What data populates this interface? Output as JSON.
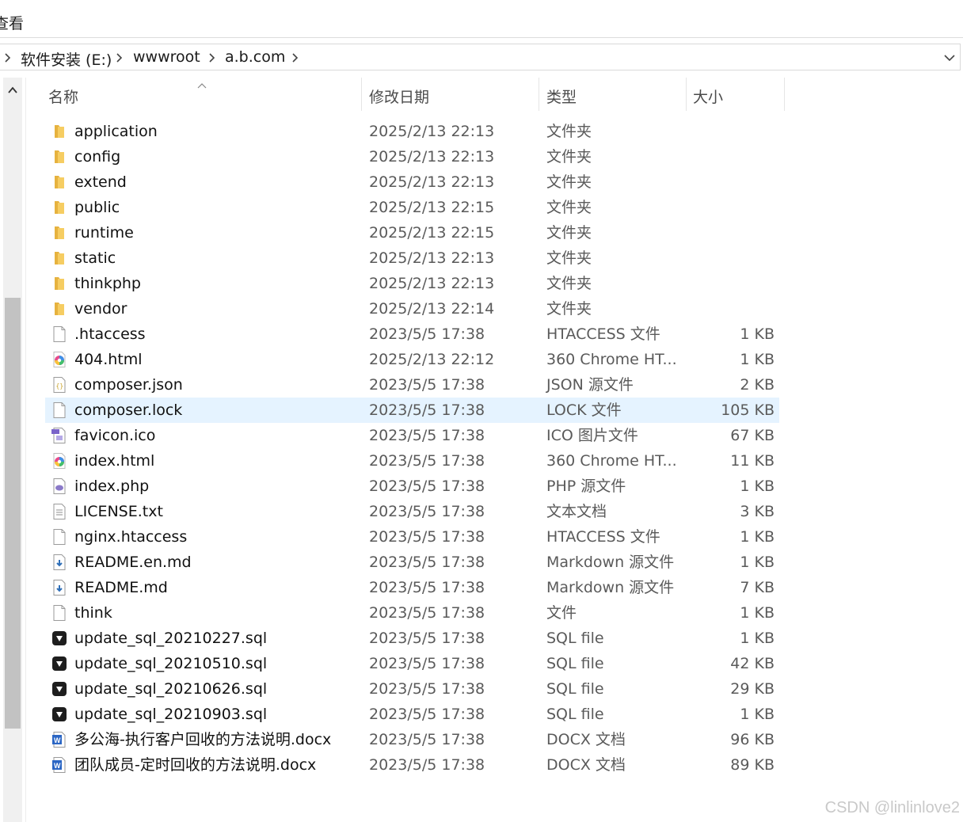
{
  "menu": {
    "view_label": "查看"
  },
  "address": {
    "crumbs": [
      "软件安装 (E:)",
      "wwwroot",
      "a.b.com"
    ]
  },
  "columns": {
    "name": "名称",
    "date": "修改日期",
    "type": "类型",
    "size": "大小"
  },
  "files": [
    {
      "name": "application",
      "date": "2025/2/13 22:13",
      "type": "文件夹",
      "size": "",
      "icon": "folder-icon"
    },
    {
      "name": "config",
      "date": "2025/2/13 22:13",
      "type": "文件夹",
      "size": "",
      "icon": "folder-icon"
    },
    {
      "name": "extend",
      "date": "2025/2/13 22:13",
      "type": "文件夹",
      "size": "",
      "icon": "folder-icon"
    },
    {
      "name": "public",
      "date": "2025/2/13 22:15",
      "type": "文件夹",
      "size": "",
      "icon": "folder-icon"
    },
    {
      "name": "runtime",
      "date": "2025/2/13 22:15",
      "type": "文件夹",
      "size": "",
      "icon": "folder-icon"
    },
    {
      "name": "static",
      "date": "2025/2/13 22:13",
      "type": "文件夹",
      "size": "",
      "icon": "folder-icon"
    },
    {
      "name": "thinkphp",
      "date": "2025/2/13 22:13",
      "type": "文件夹",
      "size": "",
      "icon": "folder-icon"
    },
    {
      "name": "vendor",
      "date": "2025/2/13 22:14",
      "type": "文件夹",
      "size": "",
      "icon": "folder-icon"
    },
    {
      "name": ".htaccess",
      "date": "2023/5/5 17:38",
      "type": "HTACCESS 文件",
      "size": "1 KB",
      "icon": "blank-file-icon"
    },
    {
      "name": "404.html",
      "date": "2025/2/13 22:12",
      "type": "360 Chrome HT...",
      "size": "1 KB",
      "icon": "browser-html-icon"
    },
    {
      "name": "composer.json",
      "date": "2023/5/5 17:38",
      "type": "JSON 源文件",
      "size": "2 KB",
      "icon": "json-file-icon"
    },
    {
      "name": "composer.lock",
      "date": "2023/5/5 17:38",
      "type": "LOCK 文件",
      "size": "105 KB",
      "icon": "blank-file-icon",
      "selected": true
    },
    {
      "name": "favicon.ico",
      "date": "2023/5/5 17:38",
      "type": "ICO 图片文件",
      "size": "67 KB",
      "icon": "image-file-icon"
    },
    {
      "name": "index.html",
      "date": "2023/5/5 17:38",
      "type": "360 Chrome HT...",
      "size": "11 KB",
      "icon": "browser-html-icon"
    },
    {
      "name": "index.php",
      "date": "2023/5/5 17:38",
      "type": "PHP 源文件",
      "size": "1 KB",
      "icon": "php-file-icon"
    },
    {
      "name": "LICENSE.txt",
      "date": "2023/5/5 17:38",
      "type": "文本文档",
      "size": "3 KB",
      "icon": "text-file-icon"
    },
    {
      "name": "nginx.htaccess",
      "date": "2023/5/5 17:38",
      "type": "HTACCESS 文件",
      "size": "1 KB",
      "icon": "blank-file-icon"
    },
    {
      "name": "README.en.md",
      "date": "2023/5/5 17:38",
      "type": "Markdown 源文件",
      "size": "1 KB",
      "icon": "markdown-file-icon"
    },
    {
      "name": "README.md",
      "date": "2023/5/5 17:38",
      "type": "Markdown 源文件",
      "size": "7 KB",
      "icon": "markdown-file-icon"
    },
    {
      "name": "think",
      "date": "2023/5/5 17:38",
      "type": "文件",
      "size": "1 KB",
      "icon": "blank-file-icon"
    },
    {
      "name": "update_sql_20210227.sql",
      "date": "2023/5/5 17:38",
      "type": "SQL file",
      "size": "1 KB",
      "icon": "sql-file-icon"
    },
    {
      "name": "update_sql_20210510.sql",
      "date": "2023/5/5 17:38",
      "type": "SQL file",
      "size": "42 KB",
      "icon": "sql-file-icon"
    },
    {
      "name": "update_sql_20210626.sql",
      "date": "2023/5/5 17:38",
      "type": "SQL file",
      "size": "29 KB",
      "icon": "sql-file-icon"
    },
    {
      "name": "update_sql_20210903.sql",
      "date": "2023/5/5 17:38",
      "type": "SQL file",
      "size": "1 KB",
      "icon": "sql-file-icon"
    },
    {
      "name": "多公海-执行客户回收的方法说明.docx",
      "date": "2023/5/5 17:38",
      "type": "DOCX 文档",
      "size": "96 KB",
      "icon": "word-doc-icon"
    },
    {
      "name": "团队成员-定时回收的方法说明.docx",
      "date": "2023/5/5 17:38",
      "type": "DOCX 文档",
      "size": "89 KB",
      "icon": "word-doc-icon"
    }
  ],
  "watermark": "CSDN @linlinlove2",
  "colors": {
    "selection": "#e5f3ff",
    "folder": "#f2c55c",
    "sql_icon": "#1e1e1e",
    "word_icon": "#2b66c4"
  }
}
